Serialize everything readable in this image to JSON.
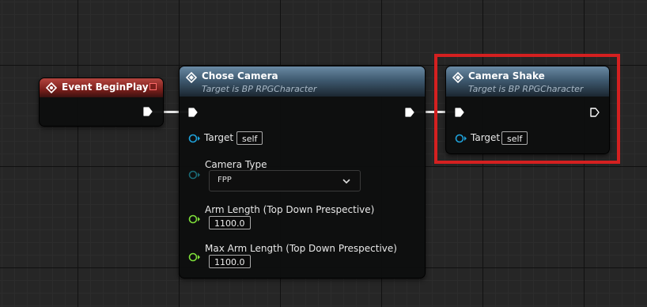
{
  "nodes": {
    "event_begin_play": {
      "title": "Event BeginPlay"
    },
    "chose_camera": {
      "title": "Chose Camera",
      "subtitle": "Target is BP RPGCharacter",
      "target_label": "Target",
      "target_value": "self",
      "camera_type_label": "Camera Type",
      "camera_type_value": "FPP",
      "arm_length_label": "Arm Length (Top Down Prespective)",
      "arm_length_value": "1100.0",
      "max_arm_length_label": "Max Arm Length (Top Down Prespective)",
      "max_arm_length_value": "1100.0"
    },
    "camera_shake": {
      "title": "Camera Shake",
      "subtitle": "Target is BP RPGCharacter",
      "target_label": "Target",
      "target_value": "self"
    }
  },
  "colors": {
    "object_pin": "#1fa3dc",
    "enum_pin": "#1a6a76",
    "float_pin": "#7ee03a",
    "highlight": "#d42020",
    "event_header": "#8a2a25",
    "function_header": "#4f6b82"
  },
  "icons": {
    "function": "function-diamond-icon",
    "event": "event-diamond-icon",
    "exec": "exec-arrow-pin-icon",
    "dropdown": "chevron-down-icon"
  }
}
